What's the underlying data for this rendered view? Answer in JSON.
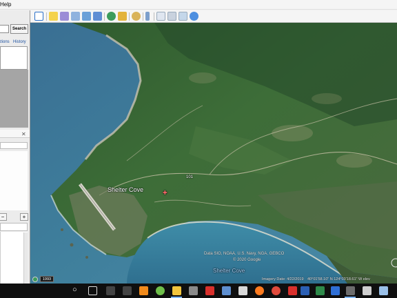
{
  "menu": {
    "help_label": "Help"
  },
  "search": {
    "button_label": "Search",
    "input_value": ""
  },
  "sidebar": {
    "tabs": [
      "ctions",
      "History"
    ],
    "close_glyph": "✕",
    "minus_glyph": "−",
    "plus_glyph": "+"
  },
  "map": {
    "place_label": "Shelter Cove",
    "water_label": "Shelter Cove",
    "route_marker": "101",
    "attribution_line1": "Data SIO, NOAA, U.S. Navy, NGA, GEBCO",
    "attribution_line2": "© 2020 Google"
  },
  "status": {
    "year": "1993",
    "imagery_date": "Imagery Date: 4/22/2019",
    "coordinates": "40°01'58.10\" N   124°03'18.61\" W   elev"
  },
  "toolbar_icons": [
    "sidebar-toggle-icon",
    "placemark-icon",
    "polygon-icon",
    "path-icon",
    "image-overlay-icon",
    "tour-icon",
    "historical-imagery-icon",
    "sunlight-icon",
    "planets-icon",
    "ruler-icon",
    "email-icon",
    "print-icon",
    "save-image-icon",
    "view-in-maps-icon"
  ],
  "taskbar_icons": [
    "start-icon",
    "search-circle-icon",
    "task-view-icon",
    "vlc-icon",
    "app-icon",
    "file-explorer-icon",
    "store-icon",
    "acrobat-icon",
    "firefox-icon",
    "chrome-icon",
    "onedrive-icon",
    "acrobat-reader-icon",
    "word-icon",
    "excel-icon",
    "google-earth-icon",
    "notepad-icon"
  ],
  "colors": {
    "water": "#3f7f9c",
    "land": "#3b6a36",
    "taskbar": "#0f0f0f",
    "link": "#1a4fa0"
  }
}
